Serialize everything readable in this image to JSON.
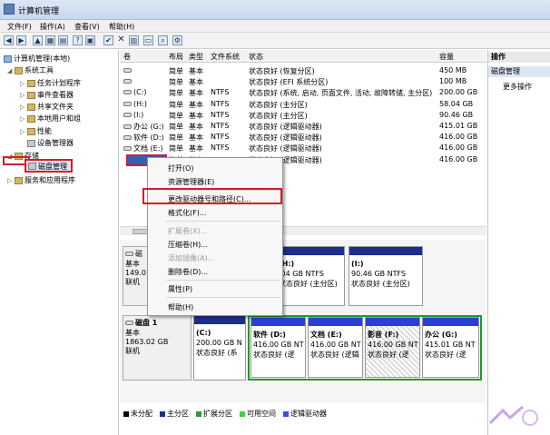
{
  "window": {
    "title": "计算机管理"
  },
  "menu": [
    "文件(F)",
    "操作(A)",
    "查看(V)",
    "帮助(H)"
  ],
  "tree": {
    "root": "计算机管理(本地)",
    "system_tools": "系统工具",
    "task_scheduler": "任务计划程序",
    "event_viewer": "事件查看器",
    "shared_folders": "共享文件夹",
    "local_users": "本地用户和组",
    "performance": "性能",
    "device_manager": "设备管理器",
    "storage": "存储",
    "disk_management": "磁盘管理",
    "services": "服务和应用程序"
  },
  "volumes": {
    "headers": [
      "卷",
      "布局",
      "类型",
      "文件系统",
      "状态",
      "容量"
    ],
    "rows": [
      [
        "",
        "简单",
        "基本",
        "",
        "状态良好 (恢复分区)",
        "450 MB"
      ],
      [
        "",
        "简单",
        "基本",
        "",
        "状态良好 (EFI 系统分区)",
        "100 MB"
      ],
      [
        "(C:)",
        "简单",
        "基本",
        "NTFS",
        "状态良好 (系统, 启动, 页面文件, 活动, 故障转储, 主分区)",
        "200.00 GB"
      ],
      [
        "(H:)",
        "简单",
        "基本",
        "NTFS",
        "状态良好 (主分区)",
        "58.04 GB"
      ],
      [
        "(I:)",
        "简单",
        "基本",
        "NTFS",
        "状态良好 (主分区)",
        "90.46 GB"
      ],
      [
        "办公 (G:)",
        "简单",
        "基本",
        "NTFS",
        "状态良好 (逻辑驱动器)",
        "415.01 GB"
      ],
      [
        "软件 (D:)",
        "简单",
        "基本",
        "NTFS",
        "状态良好 (逻辑驱动器)",
        "416.00 GB"
      ],
      [
        "文档 (E:)",
        "简单",
        "基本",
        "NTFS",
        "状态良好 (逻辑驱动器)",
        "416.00 GB"
      ],
      [
        "",
        "简单",
        "基本",
        "",
        "状态良好 (逻辑驱动器)",
        "416.00 GB"
      ]
    ]
  },
  "disk0": {
    "label": "磁",
    "type": "基本",
    "size": "149.0",
    "status": "联机"
  },
  "disk0_parts": [
    {
      "name": "(H:)",
      "size": ".04 GB NTFS",
      "status": "状态良好 (主分区)"
    },
    {
      "name": "(I:)",
      "size": "90.46 GB NTFS",
      "status": "状态良好 (主分区)"
    }
  ],
  "disk1": {
    "label": "磁盘 1",
    "type": "基本",
    "size": "1863.02 GB",
    "status": "联机"
  },
  "disk1_parts": [
    {
      "name": "(C:)",
      "size": "200.00 GB N",
      "status": "状态良好 (系"
    },
    {
      "name": "软件  (D:)",
      "size": "416.00 GB NT",
      "status": "状态良好 (逻"
    },
    {
      "name": "文档  (E:)",
      "size": "416.00 GB NT",
      "status": "状态良好 (逻辑"
    },
    {
      "name": "影音  (F:)",
      "size": "416.00 GB NT",
      "status": "状态良好 (逻"
    },
    {
      "name": "办公  (G:)",
      "size": "415.01 GB NT",
      "status": "状态良好 (逻"
    }
  ],
  "legend": [
    "未分配",
    "主分区",
    "扩展分区",
    "可用空间",
    "逻辑驱动器"
  ],
  "legend_colors": [
    "#000000",
    "#1c2f8f",
    "#2e9b2e",
    "#39d439",
    "#3a4de0"
  ],
  "actions": {
    "header": "操作",
    "section": "磁盘管理",
    "more": "更多操作"
  },
  "context_menu": {
    "open": "打开(O)",
    "explore": "资源管理器(E)",
    "change_letter": "更改驱动器号和路径(C)...",
    "format": "格式化(F)...",
    "extend": "扩展卷(X)...",
    "shrink": "压缩卷(H)...",
    "add_mirror": "添加镜像(A)...",
    "delete": "删除卷(D)...",
    "properties": "属性(P)",
    "help": "帮助(H)"
  }
}
